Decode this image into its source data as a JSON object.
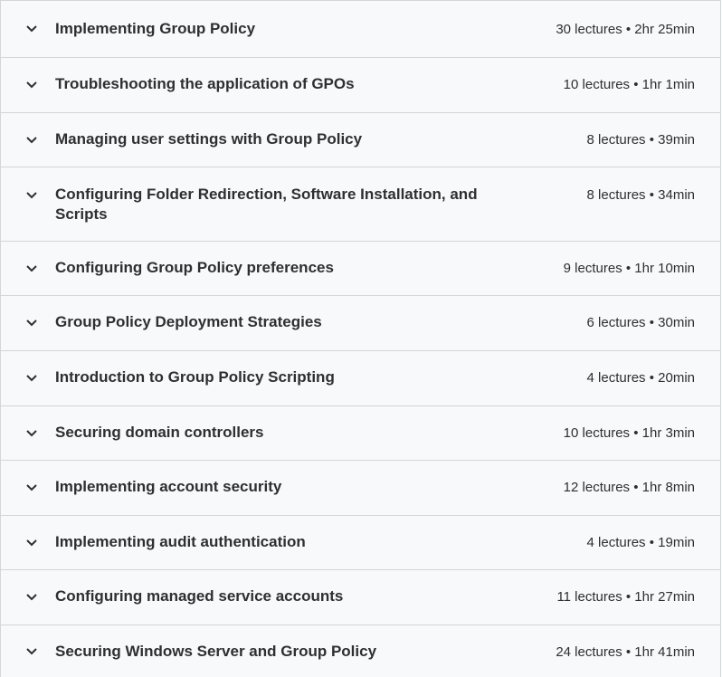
{
  "sections": [
    {
      "title": "Implementing Group Policy",
      "meta": "30 lectures • 2hr 25min"
    },
    {
      "title": "Troubleshooting the application of GPOs",
      "meta": "10 lectures • 1hr 1min"
    },
    {
      "title": "Managing user settings with Group Policy",
      "meta": "8 lectures • 39min"
    },
    {
      "title": "Configuring Folder Redirection, Software Installation, and Scripts",
      "meta": "8 lectures • 34min"
    },
    {
      "title": "Configuring Group Policy preferences",
      "meta": "9 lectures • 1hr 10min"
    },
    {
      "title": "Group Policy Deployment Strategies",
      "meta": "6 lectures • 30min"
    },
    {
      "title": "Introduction to Group Policy Scripting",
      "meta": "4 lectures • 20min"
    },
    {
      "title": "Securing domain controllers",
      "meta": "10 lectures • 1hr 3min"
    },
    {
      "title": "Implementing account security",
      "meta": "12 lectures • 1hr 8min"
    },
    {
      "title": "Implementing audit authentication",
      "meta": "4 lectures • 19min"
    },
    {
      "title": "Configuring managed service accounts",
      "meta": "11 lectures • 1hr 27min"
    },
    {
      "title": "Securing Windows Server and Group Policy",
      "meta": "24 lectures • 1hr 41min"
    }
  ],
  "icons": {
    "expand": "chevron-down-icon"
  },
  "colors": {
    "background": "#f7f9fa",
    "border": "#d1d7dc",
    "text": "#2d2f31"
  }
}
